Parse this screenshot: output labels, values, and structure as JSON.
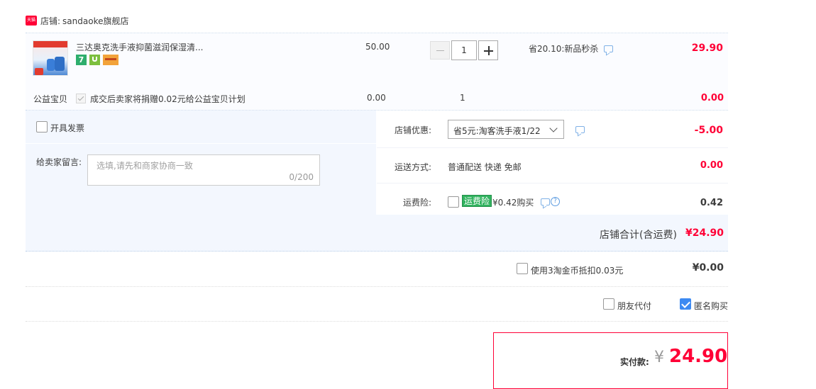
{
  "shop": {
    "badge": "天猫",
    "label": "店铺:",
    "name": "sandaoke旗舰店"
  },
  "product": {
    "title": "三达奥克洗手液抑菌滋润保湿清...",
    "price": "50.00",
    "quantity": "1",
    "promo": "省20.10:新品秒杀",
    "subtotal": "29.90",
    "service_icons": [
      "seven-day-return-icon",
      "guarantee-icon",
      "credit-card-icon"
    ],
    "icon_text_seven": "7"
  },
  "charity": {
    "label": "公益宝贝",
    "text": "成交后卖家将捐赠0.02元给公益宝贝计划",
    "price": "0.00",
    "quantity": "1",
    "subtotal": "0.00"
  },
  "invoice": {
    "label": "开具发票"
  },
  "message": {
    "label": "给卖家留言:",
    "placeholder": "选填,请先和商家协商一致",
    "counter": "0/200"
  },
  "discount": {
    "label": "店铺优惠:",
    "selected": "省5元:淘客洗手液1/22",
    "amount": "-5.00"
  },
  "shipping": {
    "label": "运送方式:",
    "method": "普通配送 快递 免邮",
    "amount": "0.00"
  },
  "insurance": {
    "label": "运费险:",
    "tag": "运费险",
    "text": "¥0.42购买",
    "amount": "0.42"
  },
  "shop_total": {
    "label": "店铺合计(含运费)",
    "amount": "¥24.90"
  },
  "coins": {
    "label": "使用3淘金币抵扣0.03元",
    "amount": "¥0.00"
  },
  "options": {
    "friend_pay": "朋友代付",
    "anonymous": "匿名购买"
  },
  "payment": {
    "label": "实付款:",
    "currency": "¥",
    "amount": "24.90"
  },
  "colors": {
    "accent": "#ff0036",
    "panel_bg": "#f3f7fe",
    "check_blue": "#3d8af2",
    "green_tag": "#31b35f"
  }
}
